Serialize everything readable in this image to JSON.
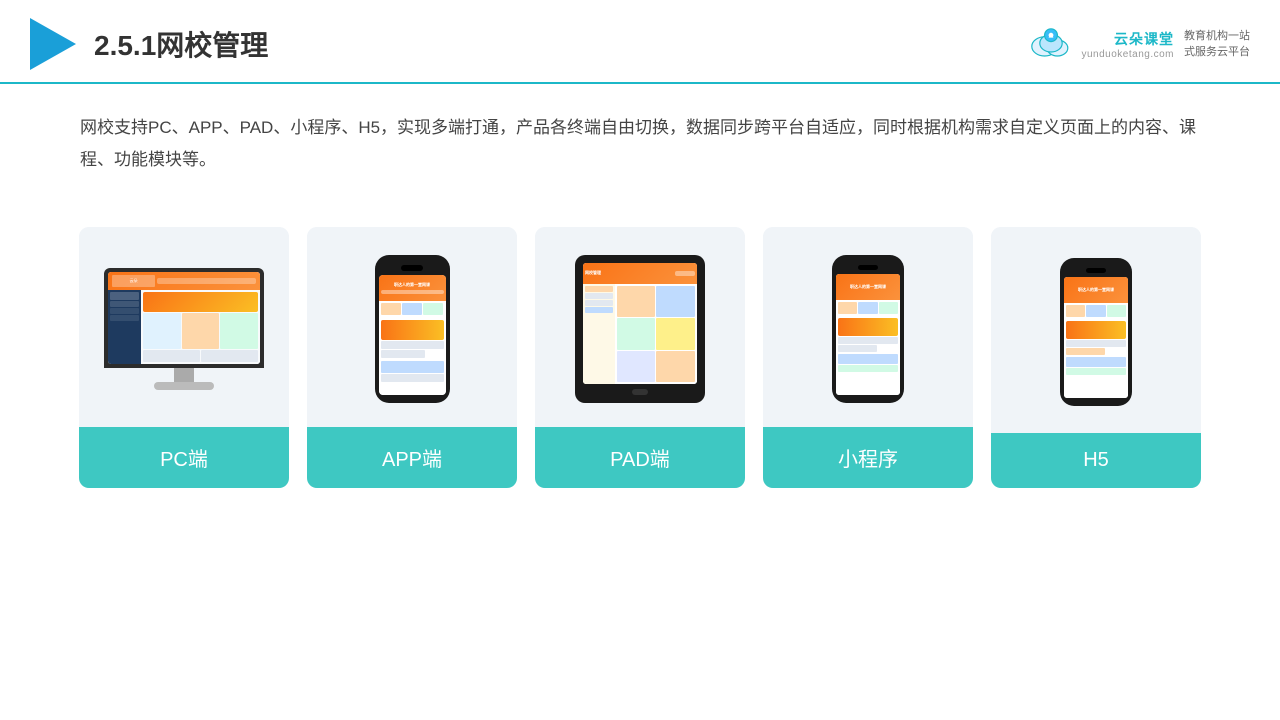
{
  "header": {
    "title": "2.5.1网校管理",
    "brand": {
      "name_cn": "云朵课堂",
      "name_en": "yunduoketang.com",
      "tagline_line1": "教育机构一站",
      "tagline_line2": "式服务云平台"
    }
  },
  "description": {
    "text": "网校支持PC、APP、PAD、小程序、H5，实现多端打通，产品各终端自由切换，数据同步跨平台自适应，同时根据机构需求自定义页面上的内容、课程、功能模块等。"
  },
  "cards": [
    {
      "id": "pc",
      "label": "PC端"
    },
    {
      "id": "app",
      "label": "APP端"
    },
    {
      "id": "pad",
      "label": "PAD端"
    },
    {
      "id": "mini",
      "label": "小程序"
    },
    {
      "id": "h5",
      "label": "H5"
    }
  ]
}
